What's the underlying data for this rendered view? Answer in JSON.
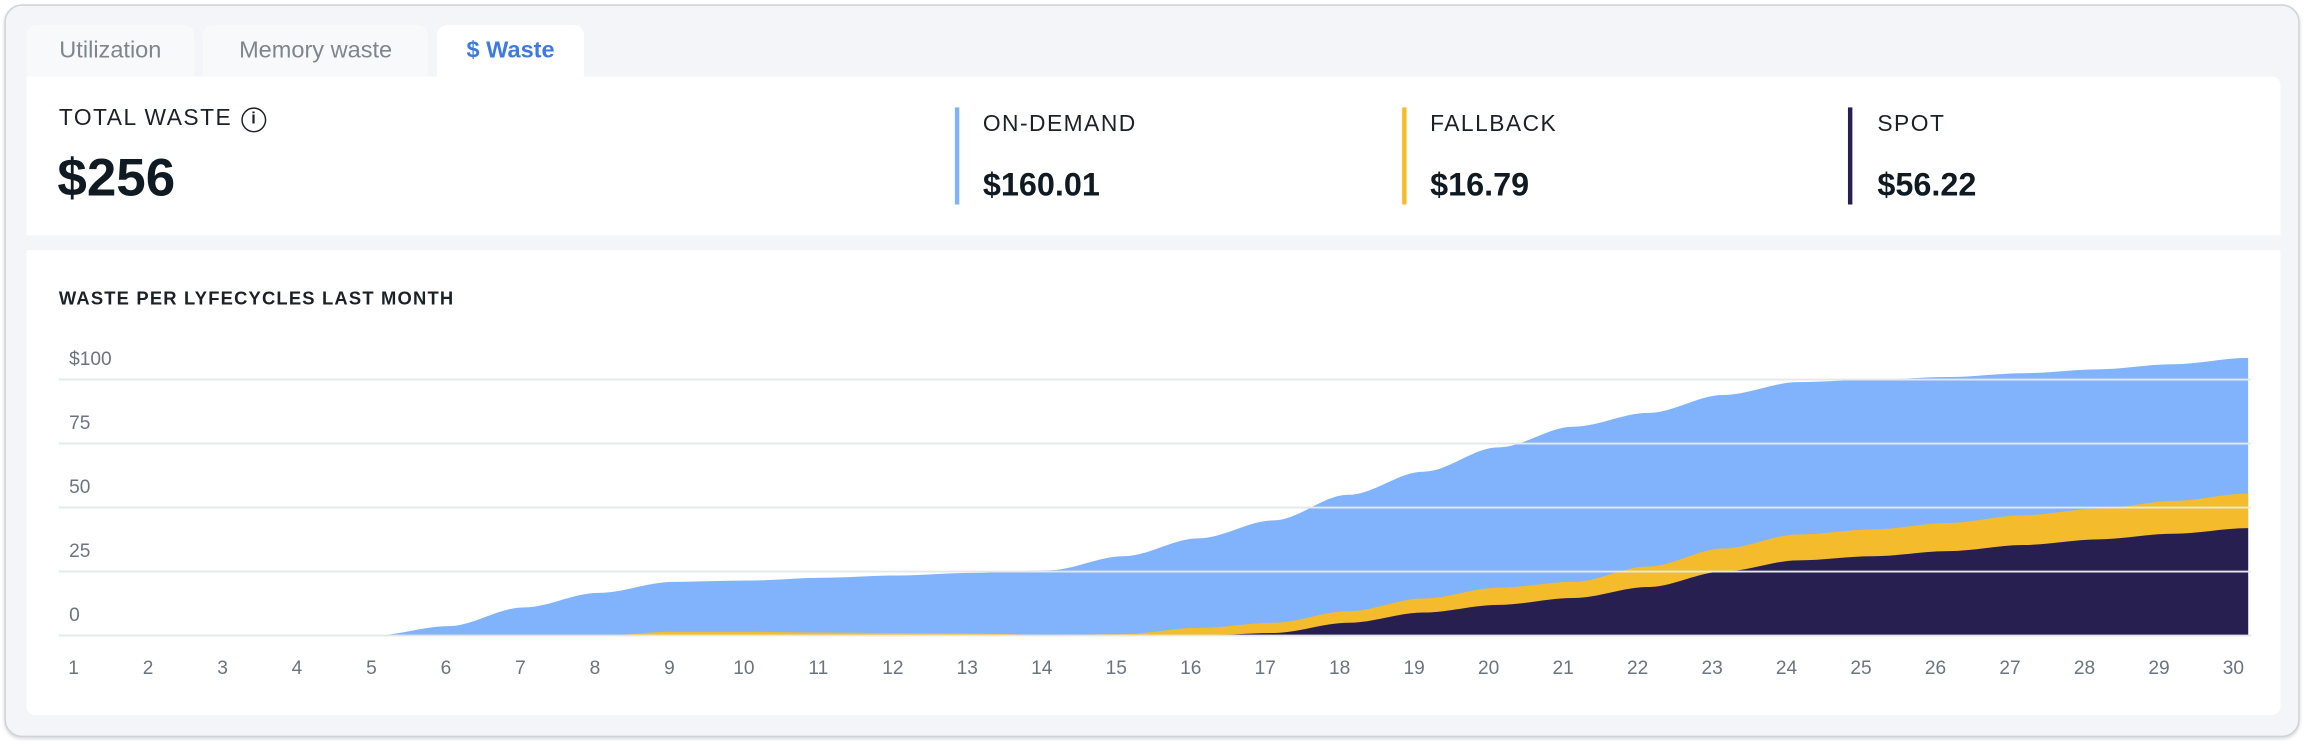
{
  "tabs": [
    {
      "label": "Utilization",
      "active": false
    },
    {
      "label": "Memory waste",
      "active": false
    },
    {
      "label": "$ Waste",
      "active": true
    }
  ],
  "summary": {
    "total_label": "TOTAL WASTE",
    "total_value": "$256",
    "info_icon": "info-icon",
    "items": [
      {
        "label": "ON-DEMAND",
        "value": "$160.01",
        "color": "#80B3FB"
      },
      {
        "label": "FALLBACK",
        "value": "$16.79",
        "color": "#F4BC2C"
      },
      {
        "label": "SPOT",
        "value": "$56.22",
        "color": "#271F4F"
      }
    ]
  },
  "colors": {
    "accent": "#3D7BE0"
  },
  "chart_data": {
    "type": "area",
    "stacked": true,
    "title": "WASTE PER LYFECYCLES LAST MONTH",
    "xlabel": "",
    "ylabel": "",
    "ylim": [
      0,
      100
    ],
    "grid": true,
    "y_ticks": [
      {
        "value": 100,
        "label": "$100"
      },
      {
        "value": 75,
        "label": "75"
      },
      {
        "value": 50,
        "label": "50"
      },
      {
        "value": 25,
        "label": "25"
      },
      {
        "value": 0,
        "label": "0"
      }
    ],
    "x": [
      "1",
      "2",
      "3",
      "4",
      "5",
      "6",
      "7",
      "8",
      "9",
      "10",
      "11",
      "12",
      "13",
      "14",
      "15",
      "16",
      "17",
      "18",
      "19",
      "20",
      "21",
      "22",
      "23",
      "24",
      "25",
      "26",
      "27",
      "28",
      "29",
      "30"
    ],
    "series": [
      {
        "key": "spot",
        "color": "#271F4F",
        "values": [
          0,
          0,
          0,
          0,
          0,
          0,
          0,
          0,
          0,
          0,
          0,
          0,
          0,
          0,
          0,
          0,
          1,
          5,
          9,
          12,
          14.7,
          19,
          25,
          29.4,
          31,
          33,
          35.4,
          37.6,
          39.8,
          42
        ]
      },
      {
        "key": "fallback",
        "color": "#F4BC2C",
        "values": [
          0,
          0,
          0,
          0,
          0,
          0,
          0,
          0,
          1.5,
          1.5,
          1.2,
          1,
          0.8,
          0.3,
          0.6,
          3,
          4,
          4.5,
          5.5,
          6.7,
          6.3,
          8,
          9,
          10.1,
          10.5,
          11,
          11.6,
          12,
          12.8,
          13.5
        ]
      },
      {
        "key": "on-demand",
        "color": "#80B3FB",
        "values": [
          0,
          0,
          0,
          0,
          0,
          3.7,
          11,
          16.7,
          19.5,
          20,
          21.4,
          22.5,
          23.7,
          25.2,
          30.4,
          35,
          40,
          45.5,
          49.5,
          54.8,
          60.6,
          60,
          60,
          59.5,
          58.5,
          57,
          55.5,
          54.4,
          53.4,
          53
        ]
      }
    ]
  }
}
